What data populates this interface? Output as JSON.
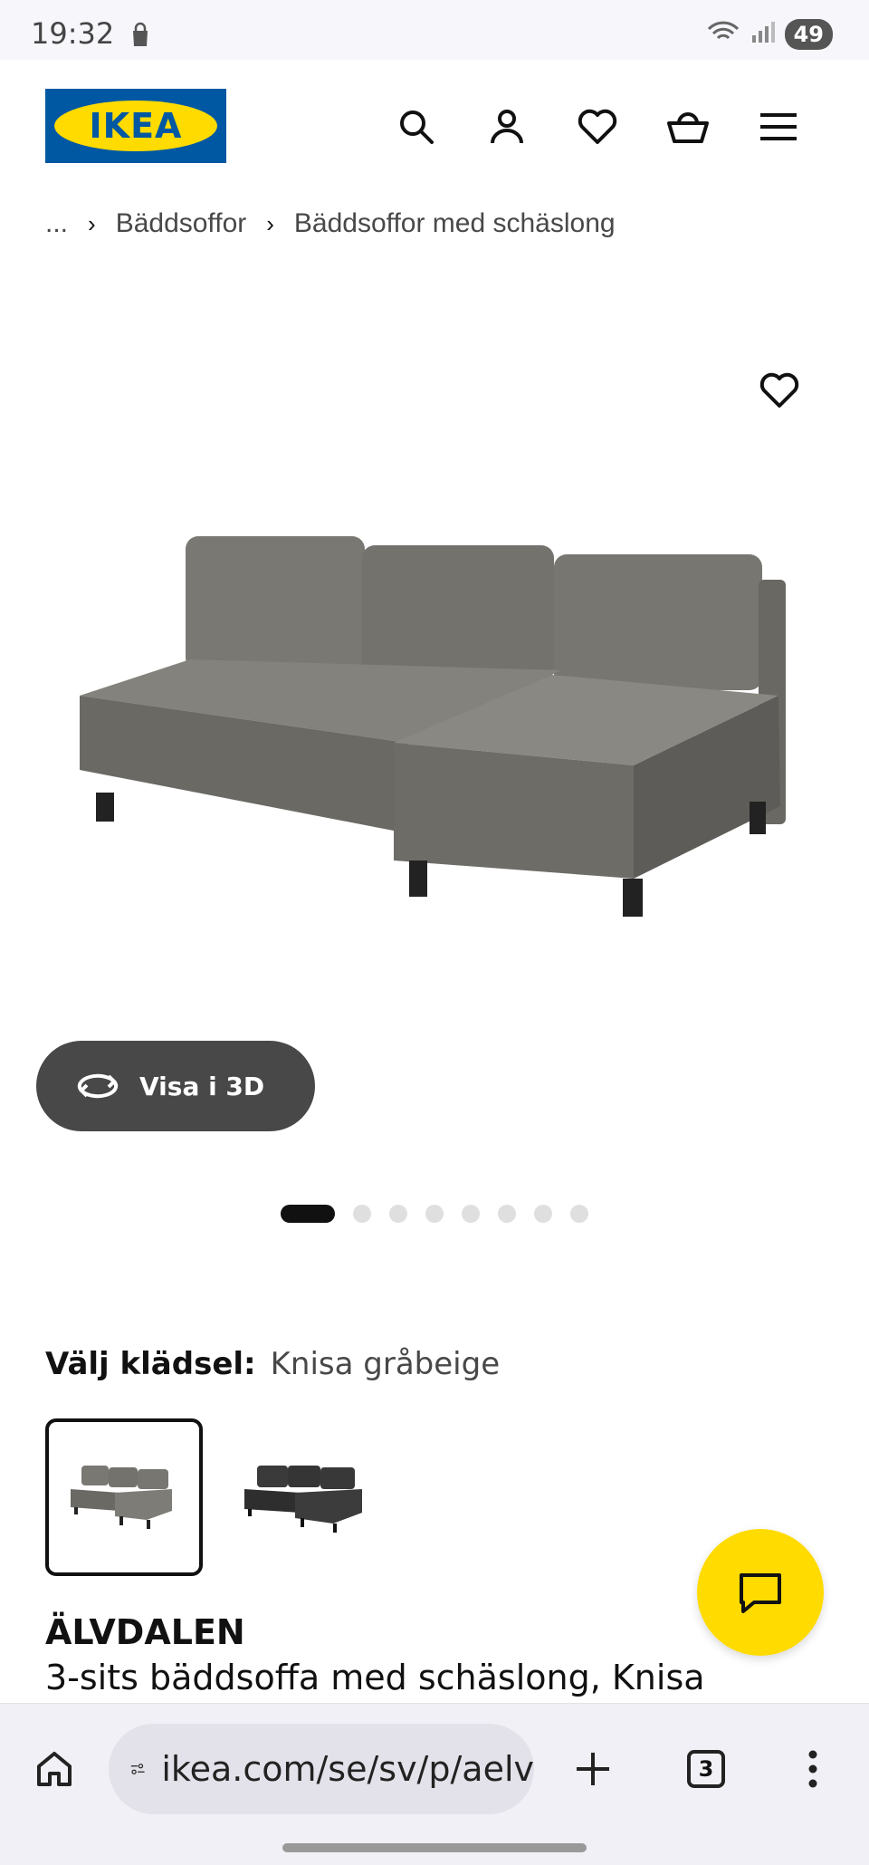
{
  "status_bar": {
    "time": "19:32",
    "battery": "49"
  },
  "header": {
    "logo_text": "IKEA"
  },
  "breadcrumb": {
    "ellipsis": "...",
    "items": [
      "Bäddsoffor",
      "Bäddsoffor med schäslong"
    ]
  },
  "gallery": {
    "view_3d_label": "Visa i 3D",
    "dot_count": 8,
    "active_index": 0
  },
  "cover": {
    "label": "Välj klädsel:",
    "value": "Knisa gråbeige"
  },
  "product": {
    "name": "ÄLVDALEN",
    "description": "3-sits bäddsoffa med schäslong, Knisa"
  },
  "browser": {
    "url": "ikea.com/se/sv/p/aelv",
    "tab_count": "3"
  },
  "colors": {
    "ikea_blue": "#0058a3",
    "ikea_yellow": "#ffdb00",
    "sofa_gray": "#6f6d68",
    "sofa_dark": "#3a3a3a"
  }
}
